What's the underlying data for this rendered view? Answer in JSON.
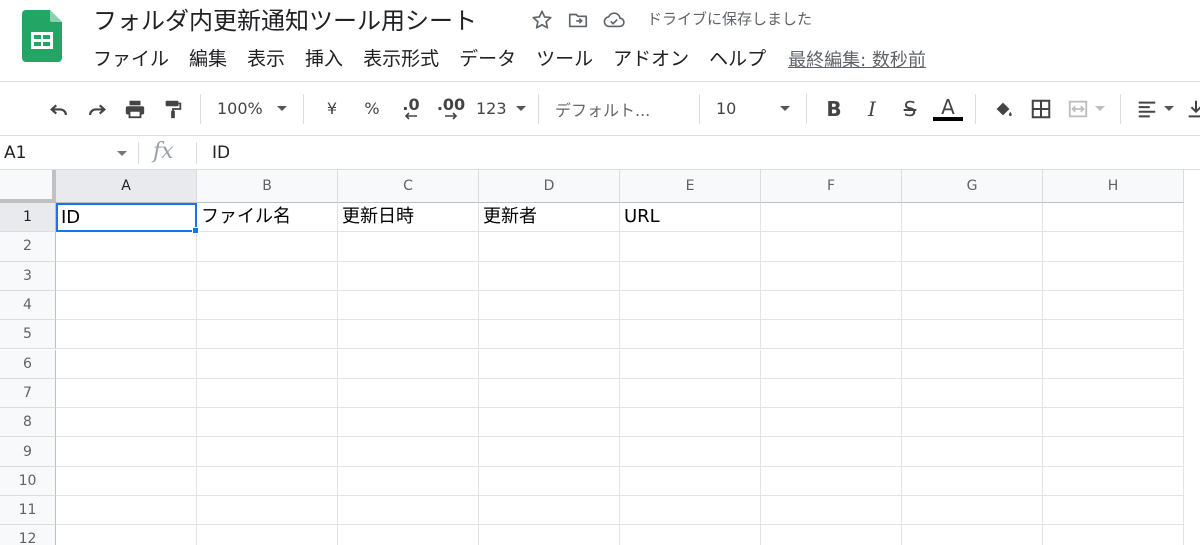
{
  "document": {
    "title": "フォルダ内更新通知ツール用シート",
    "save_status": "ドライブに保存しました"
  },
  "menu": {
    "items": [
      "ファイル",
      "編集",
      "表示",
      "挿入",
      "表示形式",
      "データ",
      "ツール",
      "アドオン",
      "ヘルプ"
    ],
    "last_edit": "最終編集: 数秒前"
  },
  "toolbar": {
    "zoom": "100%",
    "currency": "¥",
    "percent": "%",
    "decrease_decimal": ".0",
    "increase_decimal": ".00",
    "more_formats": "123",
    "font": "デフォルト...",
    "font_size": "10",
    "bold": "B",
    "italic": "I",
    "strike": "S",
    "text_color": "A",
    "text_color_value": "#000000"
  },
  "formula_bar": {
    "name_box": "A1",
    "fx": "fx",
    "content": "ID"
  },
  "sheet": {
    "columns": [
      "A",
      "B",
      "C",
      "D",
      "E",
      "F",
      "G",
      "H"
    ],
    "rows": [
      "1",
      "2",
      "3",
      "4",
      "5",
      "6",
      "7",
      "8",
      "9",
      "10",
      "11",
      "12"
    ],
    "row1": [
      "ID",
      "ファイル名",
      "更新日時",
      "更新者",
      "URL",
      "",
      "",
      ""
    ],
    "active_cell": "A1"
  },
  "colors": {
    "sheets_green": "#0f9d58",
    "selection_blue": "#1a73e8"
  }
}
